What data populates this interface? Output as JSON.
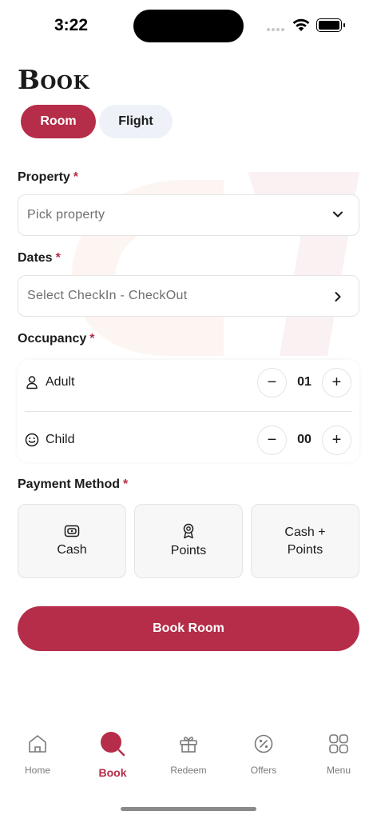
{
  "status_bar": {
    "time": "3:22"
  },
  "page": {
    "title": "Book"
  },
  "booking_type": {
    "options": [
      "Room",
      "Flight"
    ],
    "selected": "Room"
  },
  "property": {
    "label": "Property",
    "required_mark": "*",
    "placeholder": "Pick property",
    "icon": "chevron-down-icon"
  },
  "dates": {
    "label": "Dates",
    "required_mark": "*",
    "placeholder": "Select CheckIn - CheckOut",
    "icon": "chevron-right-icon"
  },
  "occupancy": {
    "label": "Occupancy",
    "required_mark": "*",
    "rows": [
      {
        "label": "Adult",
        "value": "01",
        "icon": "person-icon"
      },
      {
        "label": "Child",
        "value": "00",
        "icon": "smiley-icon"
      }
    ],
    "decrement": "−",
    "increment": "+"
  },
  "payment": {
    "label": "Payment Method",
    "required_mark": "*",
    "options": [
      {
        "label": "Cash",
        "icon": "cash-icon"
      },
      {
        "label": "Points",
        "icon": "badge-icon"
      },
      {
        "label": "Cash + Points",
        "icon": ""
      }
    ]
  },
  "book_button": {
    "label": "Book Room"
  },
  "bottom_nav": {
    "items": [
      {
        "label": "Home",
        "icon": "home-icon"
      },
      {
        "label": "Book",
        "icon": "book-search-icon",
        "active": true
      },
      {
        "label": "Redeem",
        "icon": "gift-icon"
      },
      {
        "label": "Offers",
        "icon": "percent-icon"
      },
      {
        "label": "Menu",
        "icon": "grid-icon"
      }
    ]
  },
  "colors": {
    "accent": "#b52d48",
    "segment_inactive": "#eef2f8",
    "border": "#e4e4e4",
    "card_bg": "#f7f7f7"
  }
}
